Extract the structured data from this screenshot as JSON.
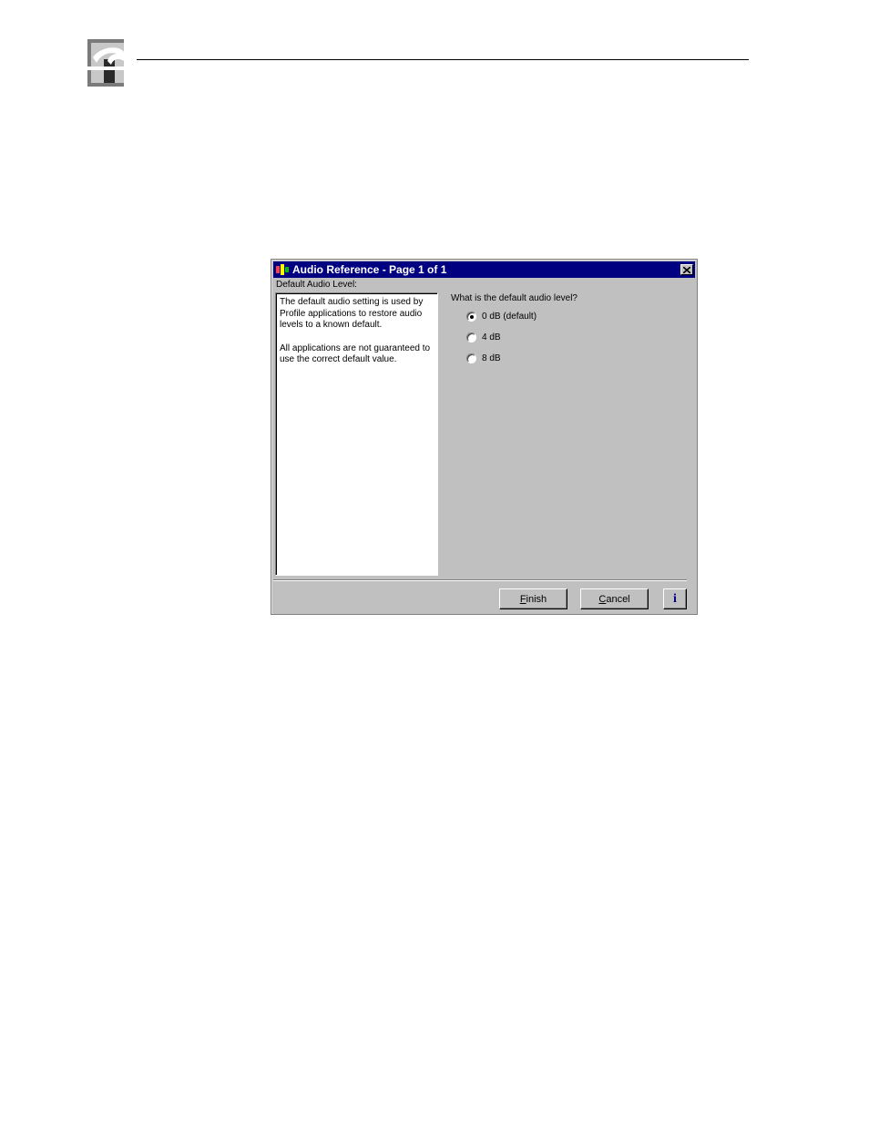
{
  "dialog": {
    "title": "Audio Reference - Page 1 of 1",
    "section_label": "Default Audio Level:",
    "help_text": [
      "The default audio setting is used by Profile applications to restore audio levels to a known default.",
      "All applications are not guaranteed to use the correct default value."
    ],
    "question": "What is the default audio level?",
    "options": [
      {
        "label": "0 dB (default)",
        "selected": true
      },
      {
        "label": "4 dB",
        "selected": false
      },
      {
        "label": "8 dB",
        "selected": false
      }
    ],
    "buttons": {
      "finish_mnemonic": "F",
      "finish_rest": "inish",
      "cancel_mnemonic": "C",
      "cancel_rest": "ancel",
      "info": "i"
    }
  },
  "icons": {
    "logo": "profile-logo-icon",
    "app": "app-icon",
    "close": "close-icon"
  },
  "colors": {
    "titlebar": "#000080",
    "dialog_bg": "#c0c0c0"
  }
}
